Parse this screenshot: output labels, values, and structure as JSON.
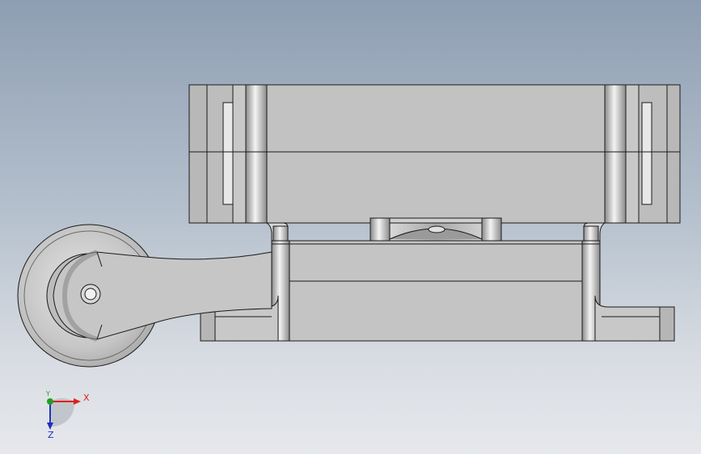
{
  "viewport": {
    "background_top": "#8e9eb2",
    "background_bottom": "#e6e8ec",
    "part_fill": "#c0c0c0",
    "edge_color": "#1a1a1a"
  },
  "triad": {
    "x_label": "X",
    "y_label": "Y",
    "z_label": "Z",
    "x_color": "#e02020",
    "y_color": "#20a020",
    "z_color": "#2030c0"
  }
}
